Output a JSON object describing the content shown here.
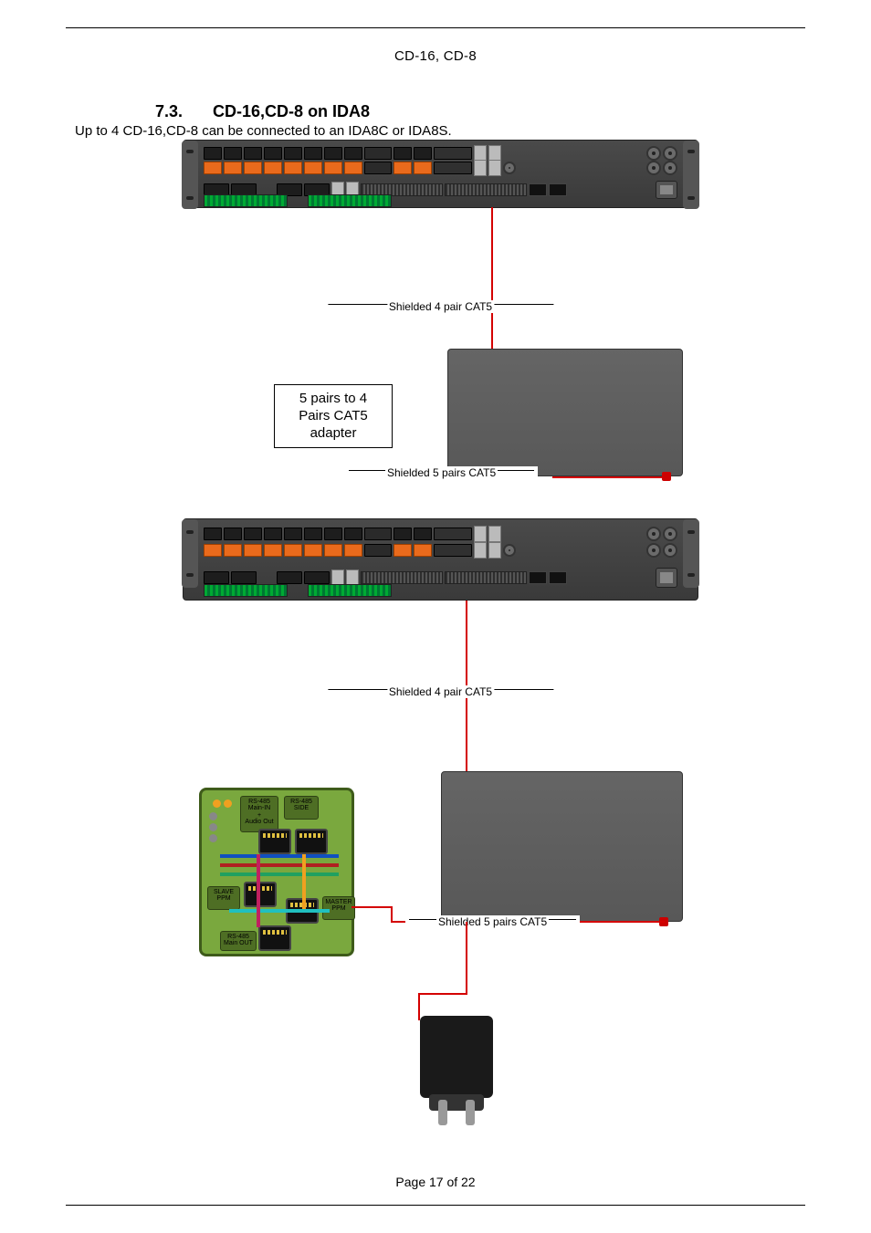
{
  "header": {
    "device_title": "CD-16, CD-8"
  },
  "section": {
    "number": "7.3.",
    "title": "CD-16,CD-8 on IDA8",
    "intro": "Up to 4 CD-16,CD-8 can be connected to an IDA8C or IDA8S."
  },
  "diagram": {
    "cat5_4pair_label_1": "Shielded 4 pair CAT5",
    "cat5_4pair_label_2": "Shielded 4 pair CAT5",
    "cat5_5pair_label_1": "Shielded 5 pairs CAT5",
    "cat5_5pair_label_2": "Shielded 5 pairs CAT5",
    "adapter_caption_line1": "5 pairs to 4",
    "adapter_caption_line2": "Pairs CAT5",
    "adapter_caption_line3": "adapter",
    "pcb": {
      "rs485_in": "RS-485\nMain-IN\n+\nAudio Out",
      "rs485_side": "RS-485\nSIDE",
      "rs485_out": "RS-485\nMain OUT",
      "slave_ppm": "SLAVE\nPPM",
      "master_ppm": "MASTER\nPPM"
    }
  },
  "footer": {
    "page_label": "Page 17 of 22"
  }
}
